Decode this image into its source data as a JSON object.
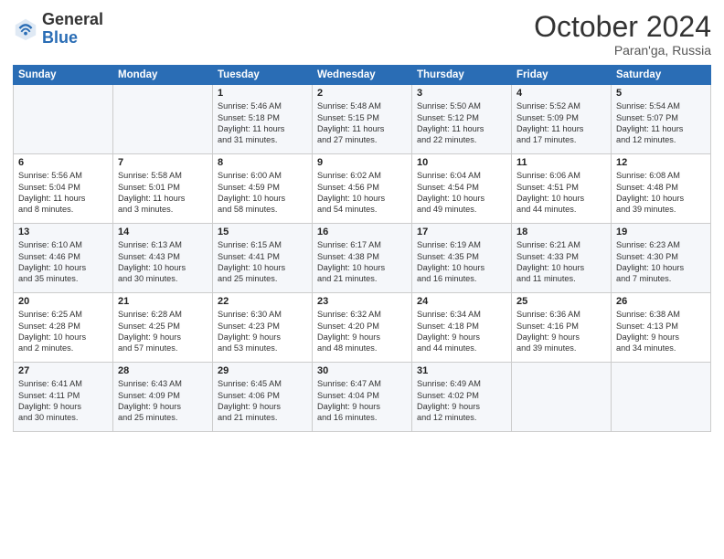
{
  "header": {
    "logo_general": "General",
    "logo_blue": "Blue",
    "month": "October 2024",
    "location": "Paran'ga, Russia"
  },
  "days_of_week": [
    "Sunday",
    "Monday",
    "Tuesday",
    "Wednesday",
    "Thursday",
    "Friday",
    "Saturday"
  ],
  "weeks": [
    [
      {
        "day": "",
        "content": ""
      },
      {
        "day": "",
        "content": ""
      },
      {
        "day": "1",
        "content": "Sunrise: 5:46 AM\nSunset: 5:18 PM\nDaylight: 11 hours\nand 31 minutes."
      },
      {
        "day": "2",
        "content": "Sunrise: 5:48 AM\nSunset: 5:15 PM\nDaylight: 11 hours\nand 27 minutes."
      },
      {
        "day": "3",
        "content": "Sunrise: 5:50 AM\nSunset: 5:12 PM\nDaylight: 11 hours\nand 22 minutes."
      },
      {
        "day": "4",
        "content": "Sunrise: 5:52 AM\nSunset: 5:09 PM\nDaylight: 11 hours\nand 17 minutes."
      },
      {
        "day": "5",
        "content": "Sunrise: 5:54 AM\nSunset: 5:07 PM\nDaylight: 11 hours\nand 12 minutes."
      }
    ],
    [
      {
        "day": "6",
        "content": "Sunrise: 5:56 AM\nSunset: 5:04 PM\nDaylight: 11 hours\nand 8 minutes."
      },
      {
        "day": "7",
        "content": "Sunrise: 5:58 AM\nSunset: 5:01 PM\nDaylight: 11 hours\nand 3 minutes."
      },
      {
        "day": "8",
        "content": "Sunrise: 6:00 AM\nSunset: 4:59 PM\nDaylight: 10 hours\nand 58 minutes."
      },
      {
        "day": "9",
        "content": "Sunrise: 6:02 AM\nSunset: 4:56 PM\nDaylight: 10 hours\nand 54 minutes."
      },
      {
        "day": "10",
        "content": "Sunrise: 6:04 AM\nSunset: 4:54 PM\nDaylight: 10 hours\nand 49 minutes."
      },
      {
        "day": "11",
        "content": "Sunrise: 6:06 AM\nSunset: 4:51 PM\nDaylight: 10 hours\nand 44 minutes."
      },
      {
        "day": "12",
        "content": "Sunrise: 6:08 AM\nSunset: 4:48 PM\nDaylight: 10 hours\nand 39 minutes."
      }
    ],
    [
      {
        "day": "13",
        "content": "Sunrise: 6:10 AM\nSunset: 4:46 PM\nDaylight: 10 hours\nand 35 minutes."
      },
      {
        "day": "14",
        "content": "Sunrise: 6:13 AM\nSunset: 4:43 PM\nDaylight: 10 hours\nand 30 minutes."
      },
      {
        "day": "15",
        "content": "Sunrise: 6:15 AM\nSunset: 4:41 PM\nDaylight: 10 hours\nand 25 minutes."
      },
      {
        "day": "16",
        "content": "Sunrise: 6:17 AM\nSunset: 4:38 PM\nDaylight: 10 hours\nand 21 minutes."
      },
      {
        "day": "17",
        "content": "Sunrise: 6:19 AM\nSunset: 4:35 PM\nDaylight: 10 hours\nand 16 minutes."
      },
      {
        "day": "18",
        "content": "Sunrise: 6:21 AM\nSunset: 4:33 PM\nDaylight: 10 hours\nand 11 minutes."
      },
      {
        "day": "19",
        "content": "Sunrise: 6:23 AM\nSunset: 4:30 PM\nDaylight: 10 hours\nand 7 minutes."
      }
    ],
    [
      {
        "day": "20",
        "content": "Sunrise: 6:25 AM\nSunset: 4:28 PM\nDaylight: 10 hours\nand 2 minutes."
      },
      {
        "day": "21",
        "content": "Sunrise: 6:28 AM\nSunset: 4:25 PM\nDaylight: 9 hours\nand 57 minutes."
      },
      {
        "day": "22",
        "content": "Sunrise: 6:30 AM\nSunset: 4:23 PM\nDaylight: 9 hours\nand 53 minutes."
      },
      {
        "day": "23",
        "content": "Sunrise: 6:32 AM\nSunset: 4:20 PM\nDaylight: 9 hours\nand 48 minutes."
      },
      {
        "day": "24",
        "content": "Sunrise: 6:34 AM\nSunset: 4:18 PM\nDaylight: 9 hours\nand 44 minutes."
      },
      {
        "day": "25",
        "content": "Sunrise: 6:36 AM\nSunset: 4:16 PM\nDaylight: 9 hours\nand 39 minutes."
      },
      {
        "day": "26",
        "content": "Sunrise: 6:38 AM\nSunset: 4:13 PM\nDaylight: 9 hours\nand 34 minutes."
      }
    ],
    [
      {
        "day": "27",
        "content": "Sunrise: 6:41 AM\nSunset: 4:11 PM\nDaylight: 9 hours\nand 30 minutes."
      },
      {
        "day": "28",
        "content": "Sunrise: 6:43 AM\nSunset: 4:09 PM\nDaylight: 9 hours\nand 25 minutes."
      },
      {
        "day": "29",
        "content": "Sunrise: 6:45 AM\nSunset: 4:06 PM\nDaylight: 9 hours\nand 21 minutes."
      },
      {
        "day": "30",
        "content": "Sunrise: 6:47 AM\nSunset: 4:04 PM\nDaylight: 9 hours\nand 16 minutes."
      },
      {
        "day": "31",
        "content": "Sunrise: 6:49 AM\nSunset: 4:02 PM\nDaylight: 9 hours\nand 12 minutes."
      },
      {
        "day": "",
        "content": ""
      },
      {
        "day": "",
        "content": ""
      }
    ]
  ]
}
